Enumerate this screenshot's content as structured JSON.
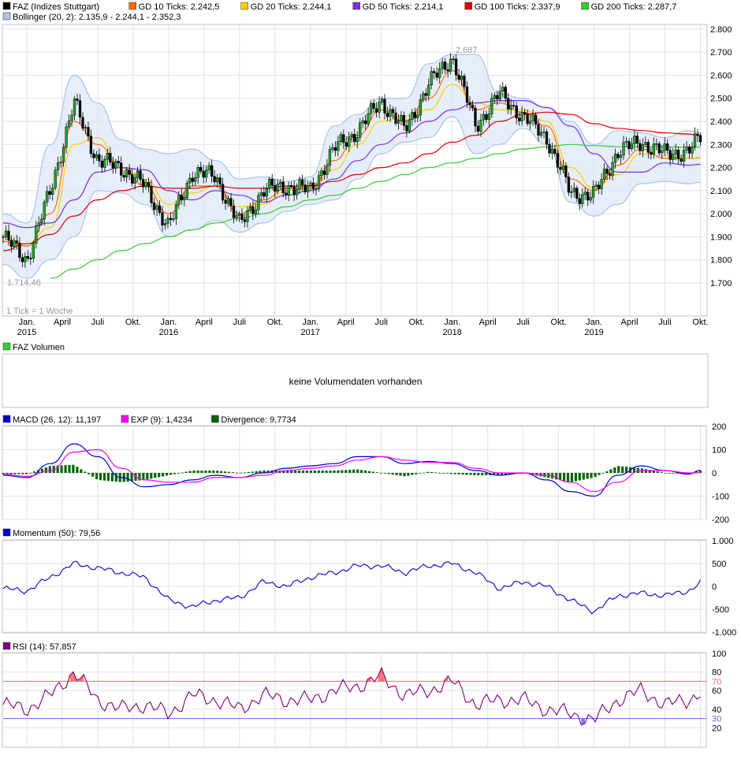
{
  "legend_main": [
    {
      "label": "FAZ (Indizes Stuttgart)",
      "color": "#000000"
    },
    {
      "label": "GD 10 Ticks: 2.242,5",
      "color": "#ff6600"
    },
    {
      "label": "GD 20 Ticks: 2.244,1",
      "color": "#ffcc00"
    },
    {
      "label": "GD 50 Ticks: 2.214,1",
      "color": "#7b2fe0"
    },
    {
      "label": "GD 100 Ticks: 2.337,9",
      "color": "#e00000"
    },
    {
      "label": "GD 200 Ticks: 2.287,7",
      "color": "#33cc33"
    },
    {
      "label": "Bollinger (20, 2): 2.135,9 - 2.244,1 - 2.352,3",
      "color": "#a9c4ea"
    }
  ],
  "main_annotations": {
    "high": "2.687",
    "low": "1.714,46",
    "tick_note": "1 Tick = 1 Woche"
  },
  "x_axis": {
    "months": [
      "Jan.",
      "April",
      "Juli",
      "Okt.",
      "Jan.",
      "April",
      "Juli",
      "Okt.",
      "Jan.",
      "April",
      "Juli",
      "Okt.",
      "Jan.",
      "April",
      "Juli",
      "Okt.",
      "Jan.",
      "April",
      "Juli",
      "Okt."
    ],
    "years": [
      "2015",
      "2016",
      "2017",
      "2018",
      "2019"
    ]
  },
  "volume_panel": {
    "legend": "FAZ Volumen",
    "message": "keine Volumendaten vorhanden",
    "color": "#33cc33"
  },
  "macd_panel": {
    "legend": [
      {
        "label": "MACD (26, 12): 11,197",
        "color": "#0000cc"
      },
      {
        "label": "EXP (9): 1,4234",
        "color": "#ff00ff"
      },
      {
        "label": "Divergence: 9,7734",
        "color": "#006600"
      }
    ]
  },
  "momentum_panel": {
    "legend": [
      {
        "label": "Momentum (50): 79,56",
        "color": "#0000cc"
      }
    ]
  },
  "rsi_panel": {
    "legend": [
      {
        "label": "RSI (14): 57,857",
        "color": "#800080"
      }
    ]
  },
  "chart_data": [
    {
      "type": "line",
      "title": "FAZ (Indizes Stuttgart)",
      "x": [
        "2014-11",
        "2015-01",
        "2015-03",
        "2015-05",
        "2015-07",
        "2015-09",
        "2015-11",
        "2016-01",
        "2016-03",
        "2016-05",
        "2016-07",
        "2016-09",
        "2016-11",
        "2017-01",
        "2017-03",
        "2017-05",
        "2017-07",
        "2017-09",
        "2017-11",
        "2018-01",
        "2018-03",
        "2018-05",
        "2018-07",
        "2018-09",
        "2018-11",
        "2019-01",
        "2019-03",
        "2019-05",
        "2019-07",
        "2019-09",
        "2019-10"
      ],
      "series": [
        {
          "name": "FAZ (Indizes Stuttgart)",
          "values": [
            1900,
            1800,
            2100,
            2480,
            2230,
            2200,
            2120,
            1940,
            2180,
            2160,
            1950,
            2100,
            2120,
            2100,
            2280,
            2360,
            2490,
            2360,
            2560,
            2680,
            2380,
            2520,
            2420,
            2330,
            2090,
            2080,
            2270,
            2310,
            2260,
            2270,
            2330
          ]
        },
        {
          "name": "GD 10 Ticks: 2.242,5",
          "values": [
            1880,
            1860,
            2000,
            2400,
            2300,
            2200,
            2120,
            2000,
            2120,
            2120,
            2000,
            2060,
            2110,
            2110,
            2230,
            2340,
            2450,
            2400,
            2500,
            2620,
            2450,
            2480,
            2440,
            2380,
            2150,
            2100,
            2210,
            2280,
            2240,
            2240,
            2242
          ]
        },
        {
          "name": "GD 20 Ticks: 2.244,1",
          "values": [
            1900,
            1870,
            1940,
            2300,
            2330,
            2200,
            2150,
            2040,
            2090,
            2120,
            2030,
            2040,
            2100,
            2110,
            2190,
            2300,
            2400,
            2420,
            2450,
            2560,
            2480,
            2450,
            2450,
            2400,
            2200,
            2110,
            2170,
            2260,
            2250,
            2240,
            2244
          ]
        },
        {
          "name": "GD 50 Ticks: 2.214,1",
          "values": [
            1960,
            1940,
            1960,
            2060,
            2180,
            2200,
            2190,
            2100,
            2060,
            2100,
            2080,
            2050,
            2080,
            2100,
            2150,
            2230,
            2300,
            2350,
            2400,
            2450,
            2480,
            2490,
            2490,
            2460,
            2380,
            2260,
            2180,
            2180,
            2220,
            2210,
            2214
          ]
        },
        {
          "name": "GD 100 Ticks: 2.337,9",
          "values": [
            1840,
            1870,
            1910,
            1990,
            2060,
            2100,
            2120,
            2110,
            2110,
            2120,
            2110,
            2110,
            2120,
            2120,
            2140,
            2170,
            2200,
            2220,
            2260,
            2310,
            2340,
            2400,
            2430,
            2440,
            2430,
            2390,
            2370,
            2360,
            2350,
            2345,
            2338
          ]
        },
        {
          "name": "GD 200 Ticks: 2.287,7",
          "values": [
            null,
            null,
            1720,
            1760,
            1800,
            1840,
            1870,
            1900,
            1930,
            1960,
            1980,
            2000,
            2030,
            2060,
            2080,
            2110,
            2140,
            2170,
            2200,
            2220,
            2240,
            2260,
            2280,
            2290,
            2300,
            2295,
            2290,
            2290,
            2290,
            2288,
            2288
          ]
        }
      ],
      "bollinger": {
        "upper": [
          2000,
          1960,
          2300,
          2600,
          2480,
          2320,
          2280,
          2260,
          2280,
          2230,
          2150,
          2160,
          2140,
          2160,
          2380,
          2430,
          2500,
          2500,
          2650,
          2690,
          2690,
          2520,
          2500,
          2460,
          2400,
          2300,
          2360,
          2350,
          2330,
          2360,
          2352
        ],
        "lower": [
          1780,
          1720,
          1800,
          1900,
          2100,
          2090,
          2040,
          1900,
          1930,
          1970,
          1920,
          1960,
          2010,
          2040,
          2060,
          2150,
          2260,
          2310,
          2330,
          2420,
          2260,
          2300,
          2370,
          2300,
          2050,
          1990,
          2040,
          2130,
          2140,
          2130,
          2136
        ]
      },
      "ylim": [
        1560,
        2820
      ],
      "yticks": [
        1700,
        1800,
        1900,
        2000,
        2100,
        2200,
        2300,
        2400,
        2500,
        2600,
        2700,
        2800
      ],
      "ytick_labels": [
        "1.700",
        "1.800",
        "1.900",
        "2.000",
        "2.100",
        "2.200",
        "2.300",
        "2.400",
        "2.500",
        "2.600",
        "2.700",
        "2.800"
      ],
      "grid": true
    },
    {
      "type": "line",
      "title": "MACD (26, 12)",
      "x": [
        "2014-11",
        "2015-01",
        "2015-03",
        "2015-05",
        "2015-07",
        "2015-09",
        "2015-11",
        "2016-01",
        "2016-03",
        "2016-05",
        "2016-07",
        "2016-09",
        "2016-11",
        "2017-01",
        "2017-03",
        "2017-05",
        "2017-07",
        "2017-09",
        "2017-11",
        "2018-01",
        "2018-03",
        "2018-05",
        "2018-07",
        "2018-09",
        "2018-11",
        "2019-01",
        "2019-03",
        "2019-05",
        "2019-07",
        "2019-09",
        "2019-10"
      ],
      "series": [
        {
          "name": "MACD (26, 12): 11,197",
          "values": [
            -10,
            -20,
            40,
            125,
            70,
            -20,
            -60,
            -50,
            -30,
            -10,
            -20,
            0,
            20,
            30,
            40,
            70,
            70,
            40,
            50,
            40,
            10,
            -10,
            0,
            -30,
            -80,
            -100,
            -10,
            30,
            10,
            -5,
            11
          ]
        },
        {
          "name": "EXP (9): 1,4234",
          "values": [
            -5,
            -15,
            10,
            90,
            100,
            20,
            -30,
            -40,
            -40,
            -20,
            -20,
            -10,
            10,
            20,
            30,
            55,
            70,
            55,
            45,
            45,
            20,
            0,
            0,
            -10,
            -40,
            -80,
            -40,
            10,
            10,
            0,
            1
          ]
        },
        {
          "name": "Divergence: 9,7734",
          "values": [
            -5,
            -5,
            30,
            35,
            -30,
            -40,
            -30,
            -10,
            10,
            10,
            0,
            10,
            10,
            10,
            10,
            15,
            0,
            -15,
            5,
            -5,
            -10,
            -10,
            0,
            -20,
            -40,
            -20,
            30,
            20,
            0,
            -5,
            10
          ]
        }
      ],
      "ylim": [
        -200,
        200
      ],
      "yticks": [
        -200,
        -100,
        0,
        100,
        200
      ]
    },
    {
      "type": "line",
      "title": "Momentum (50)",
      "x": [
        "2014-11",
        "2015-01",
        "2015-03",
        "2015-05",
        "2015-07",
        "2015-09",
        "2015-11",
        "2016-01",
        "2016-03",
        "2016-05",
        "2016-07",
        "2016-09",
        "2016-11",
        "2017-01",
        "2017-03",
        "2017-05",
        "2017-07",
        "2017-09",
        "2017-11",
        "2018-01",
        "2018-03",
        "2018-05",
        "2018-07",
        "2018-09",
        "2018-11",
        "2019-01",
        "2019-03",
        "2019-05",
        "2019-07",
        "2019-09",
        "2019-10"
      ],
      "series": [
        {
          "name": "Momentum (50): 79,56",
          "values": [
            -50,
            -100,
            200,
            500,
            400,
            300,
            200,
            -300,
            -450,
            -300,
            -250,
            100,
            0,
            200,
            300,
            450,
            450,
            300,
            450,
            500,
            300,
            -50,
            100,
            0,
            -300,
            -550,
            -200,
            -150,
            -200,
            -100,
            80
          ]
        }
      ],
      "ylim": [
        -1000,
        1000
      ],
      "yticks": [
        -1000,
        -500,
        0,
        500,
        1000
      ],
      "ytick_labels": [
        "-1.000",
        "-500",
        "0",
        "500",
        "1.000"
      ]
    },
    {
      "type": "line",
      "title": "RSI (14)",
      "x": [
        "2014-11",
        "2015-01",
        "2015-03",
        "2015-05",
        "2015-07",
        "2015-09",
        "2015-11",
        "2016-01",
        "2016-03",
        "2016-05",
        "2016-07",
        "2016-09",
        "2016-11",
        "2017-01",
        "2017-03",
        "2017-05",
        "2017-07",
        "2017-09",
        "2017-11",
        "2018-01",
        "2018-03",
        "2018-05",
        "2018-07",
        "2018-09",
        "2018-11",
        "2019-01",
        "2019-03",
        "2019-05",
        "2019-07",
        "2019-09",
        "2019-10"
      ],
      "series": [
        {
          "name": "RSI (14): 57,857",
          "values": [
            45,
            40,
            55,
            80,
            50,
            40,
            45,
            35,
            55,
            50,
            40,
            55,
            50,
            50,
            60,
            65,
            75,
            55,
            60,
            70,
            45,
            50,
            50,
            40,
            35,
            28,
            50,
            60,
            45,
            50,
            58
          ]
        }
      ],
      "reference_lines": [
        70,
        30
      ],
      "ylim": [
        0,
        100
      ],
      "yticks": [
        20,
        40,
        60,
        80,
        100
      ]
    }
  ]
}
